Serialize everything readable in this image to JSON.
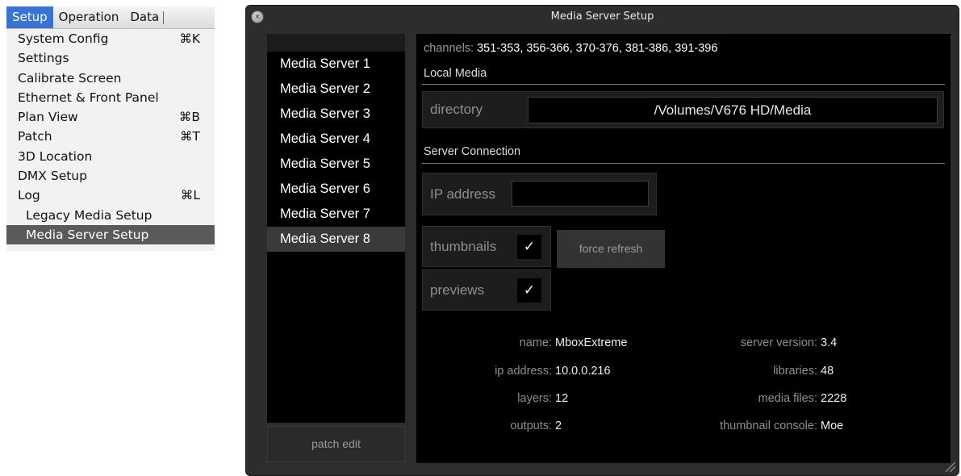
{
  "menubar": {
    "items": [
      "Setup",
      "Operation",
      "Data"
    ]
  },
  "menu": {
    "items": [
      {
        "label": "System Config",
        "shortcut": "⌘K"
      },
      {
        "label": "Settings",
        "shortcut": ""
      },
      {
        "label": "Calibrate Screen",
        "shortcut": ""
      },
      {
        "label": "Ethernet & Front Panel",
        "shortcut": ""
      },
      {
        "label": "Plan View",
        "shortcut": "⌘B"
      },
      {
        "label": "Patch",
        "shortcut": "⌘T"
      },
      {
        "label": "3D Location",
        "shortcut": ""
      },
      {
        "label": "DMX Setup",
        "shortcut": ""
      },
      {
        "label": "Log",
        "shortcut": "⌘L"
      },
      {
        "label": "Legacy Media Setup",
        "shortcut": ""
      },
      {
        "label": "Media Server Setup",
        "shortcut": ""
      }
    ]
  },
  "window": {
    "title": "Media Server Setup",
    "servers": [
      "Media Server 1",
      "Media Server 2",
      "Media Server 3",
      "Media Server 4",
      "Media Server 5",
      "Media Server 6",
      "Media Server 7",
      "Media Server 8"
    ],
    "selected_server": "Media Server 8",
    "patch_edit": "patch edit"
  },
  "panel": {
    "channels_label": "channels:",
    "channels_value": "351-353, 356-366, 370-376, 381-386, 391-396",
    "local_media_title": "Local Media",
    "directory_label": "directory",
    "directory_value": "/Volumes/V676 HD/Media",
    "server_connection_title": "Server Connection",
    "ip_label": "IP address",
    "ip_value": "",
    "thumbnails_label": "thumbnails",
    "thumbnails_check": "✓",
    "previews_label": "previews",
    "previews_check": "✓",
    "force_refresh": "force refresh"
  },
  "info": {
    "left": [
      {
        "label": "name:",
        "value": "MboxExtreme"
      },
      {
        "label": "ip address:",
        "value": "10.0.0.216"
      },
      {
        "label": "layers:",
        "value": "12"
      },
      {
        "label": "outputs:",
        "value": "2"
      }
    ],
    "right": [
      {
        "label": "server version:",
        "value": "3.4"
      },
      {
        "label": "libraries:",
        "value": "48"
      },
      {
        "label": "media files:",
        "value": "2228"
      },
      {
        "label": "thumbnail console:",
        "value": "Moe"
      }
    ]
  }
}
